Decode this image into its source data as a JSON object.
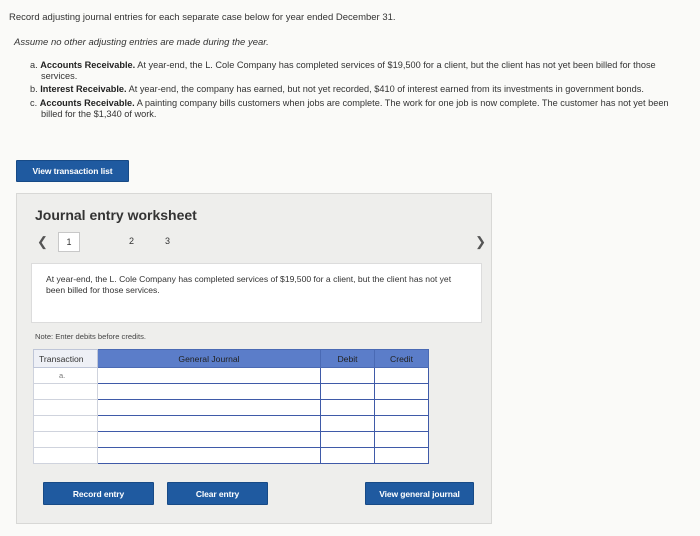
{
  "instructions": {
    "intro": "Record adjusting journal entries for each separate case below for year ended December 31.",
    "assume": "Assume no other adjusting entries are made during the year."
  },
  "cases": [
    {
      "letter": "a.",
      "title": "Accounts Receivable.",
      "text": "At year-end, the L. Cole Company has completed services of $19,500 for a client, but the client has not yet been billed for those services."
    },
    {
      "letter": "b.",
      "title": "Interest Receivable.",
      "text": "At year-end, the company has earned, but not yet recorded, $410 of interest earned from its investments in government bonds."
    },
    {
      "letter": "c.",
      "title": "Accounts Receivable.",
      "text": "A painting company bills customers when jobs are complete. The work for one job is now complete. The customer has not yet been billed for the $1,340 of work."
    }
  ],
  "buttons": {
    "view_transaction_list": "View transaction list",
    "record_entry": "Record entry",
    "clear_entry": "Clear entry",
    "view_general_journal": "View general journal"
  },
  "worksheet": {
    "title": "Journal entry worksheet",
    "pages": [
      "1",
      "2",
      "3"
    ],
    "active_page": "1",
    "description": "At year-end, the L. Cole Company has completed services of $19,500 for a client, but the client has not yet been billed for those services.",
    "note": "Note: Enter debits before credits.",
    "table": {
      "headers": {
        "transaction": "Transaction",
        "general_journal": "General Journal",
        "debit": "Debit",
        "credit": "Credit"
      },
      "rows": [
        {
          "transaction": "a."
        },
        {
          "transaction": ""
        },
        {
          "transaction": ""
        },
        {
          "transaction": ""
        },
        {
          "transaction": ""
        },
        {
          "transaction": ""
        }
      ]
    }
  },
  "colors": {
    "button": "#1f5aa0",
    "table_header": "#5b7dc9",
    "input_border": "#3f5aa8"
  },
  "icons": {
    "prev": "chevron-left-icon",
    "next": "chevron-right-icon"
  }
}
